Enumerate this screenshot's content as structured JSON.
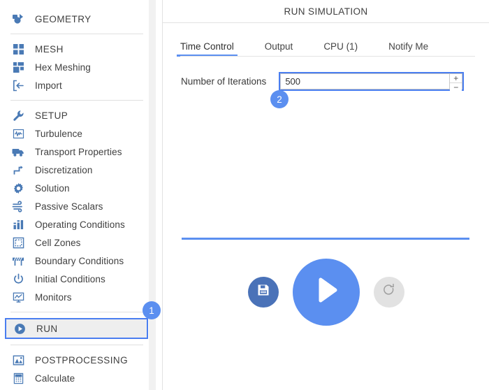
{
  "sidebar": {
    "groups": [
      {
        "id": "geometry",
        "items": [
          {
            "id": "geometry",
            "label": "GEOMETRY",
            "icon": "geometry-icon",
            "is_group": true
          }
        ]
      },
      {
        "id": "mesh",
        "items": [
          {
            "id": "mesh",
            "label": "MESH",
            "icon": "mesh-grid-icon",
            "is_group": true
          },
          {
            "id": "hex-meshing",
            "label": "Hex Meshing",
            "icon": "hex-meshing-icon",
            "is_group": false
          },
          {
            "id": "import",
            "label": "Import",
            "icon": "import-icon",
            "is_group": false
          }
        ]
      },
      {
        "id": "setup",
        "items": [
          {
            "id": "setup",
            "label": "SETUP",
            "icon": "wrench-icon",
            "is_group": true
          },
          {
            "id": "turbulence",
            "label": "Turbulence",
            "icon": "turbulence-icon",
            "is_group": false
          },
          {
            "id": "transport-properties",
            "label": "Transport Properties",
            "icon": "truck-icon",
            "is_group": false
          },
          {
            "id": "discretization",
            "label": "Discretization",
            "icon": "discretization-icon",
            "is_group": false
          },
          {
            "id": "solution",
            "label": "Solution",
            "icon": "gear-icon",
            "is_group": false
          },
          {
            "id": "passive-scalars",
            "label": "Passive Scalars",
            "icon": "passive-scalars-icon",
            "is_group": false
          },
          {
            "id": "operating-conditions",
            "label": "Operating Conditions",
            "icon": "bar-chart-icon",
            "is_group": false
          },
          {
            "id": "cell-zones",
            "label": "Cell Zones",
            "icon": "cell-zones-icon",
            "is_group": false
          },
          {
            "id": "boundary-conditions",
            "label": "Boundary Conditions",
            "icon": "barrier-icon",
            "is_group": false
          },
          {
            "id": "initial-conditions",
            "label": "Initial Conditions",
            "icon": "power-icon",
            "is_group": false
          },
          {
            "id": "monitors",
            "label": "Monitors",
            "icon": "monitor-icon",
            "is_group": false
          }
        ]
      },
      {
        "id": "run",
        "items": [
          {
            "id": "run",
            "label": "RUN",
            "icon": "play-circle-icon",
            "is_group": true,
            "selected": true
          }
        ]
      },
      {
        "id": "postprocessing",
        "items": [
          {
            "id": "postprocessing",
            "label": "POSTPROCESSING",
            "icon": "image-icon",
            "is_group": true
          },
          {
            "id": "calculate",
            "label": "Calculate",
            "icon": "calculator-icon",
            "is_group": false
          }
        ]
      }
    ]
  },
  "main": {
    "title": "RUN SIMULATION",
    "tabs": [
      {
        "id": "time-control",
        "label": "Time Control",
        "active": true
      },
      {
        "id": "output",
        "label": "Output",
        "active": false
      },
      {
        "id": "cpu",
        "label": "CPU  (1)",
        "active": false
      },
      {
        "id": "notify-me",
        "label": "Notify Me",
        "active": false
      }
    ],
    "field": {
      "label": "Number of Iterations",
      "value": "500",
      "placeholder": "",
      "increment_label": "+",
      "decrement_label": "−"
    },
    "actions": {
      "save": "save-icon",
      "run": "play-icon",
      "reset": "reset-icon"
    }
  },
  "badges": [
    {
      "id": "badge-1",
      "label": "1"
    },
    {
      "id": "badge-2",
      "label": "2"
    }
  ],
  "colors": {
    "accent": "#5b8ff0",
    "icon": "#4a7ab5",
    "save_button": "#4a72b8",
    "reset_button": "#e2e2e2",
    "text": "#3f3f3f"
  }
}
